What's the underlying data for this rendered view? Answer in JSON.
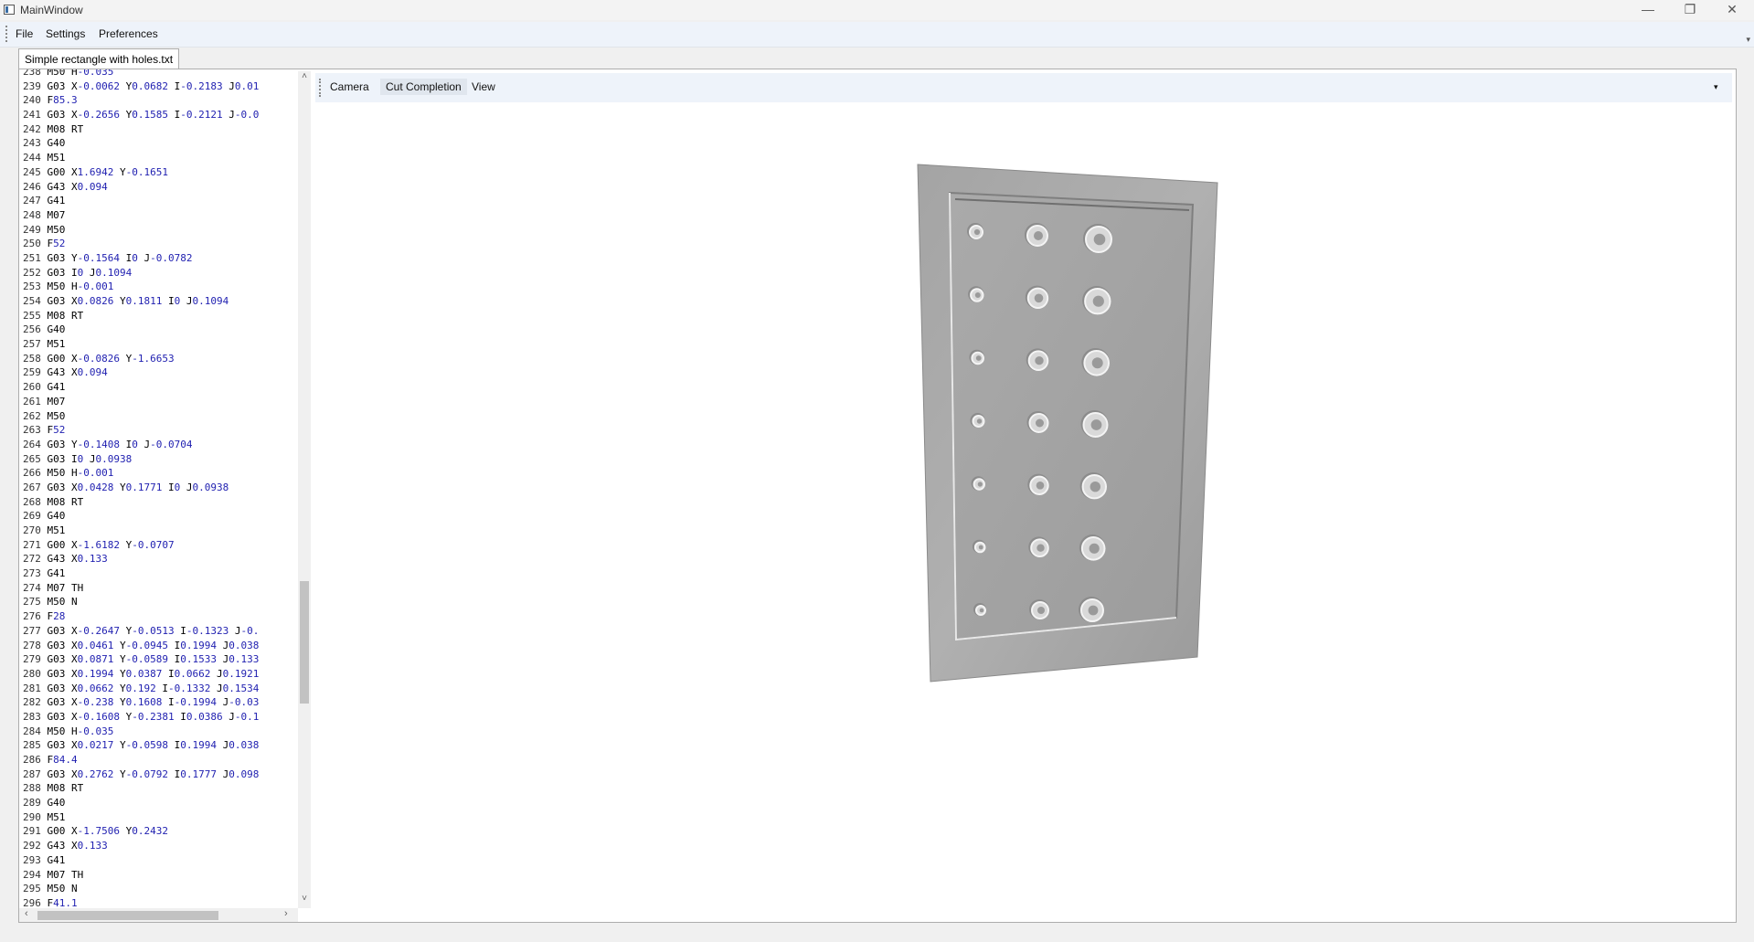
{
  "window": {
    "title": "MainWindow",
    "minimize_glyph": "—",
    "restore_glyph": "❐",
    "close_glyph": "✕"
  },
  "menu": {
    "items": [
      {
        "label": "File"
      },
      {
        "label": "Settings"
      },
      {
        "label": "Preferences"
      }
    ],
    "overflow_glyph": "▾"
  },
  "document_tab": {
    "label": "Simple rectangle with holes.txt"
  },
  "editor": {
    "lines": [
      "238 M50 H-0.035",
      "239 G03 X-0.0062 Y0.0682 I-0.2183 J0.01",
      "240 F85.3",
      "241 G03 X-0.2656 Y0.1585 I-0.2121 J-0.0",
      "242 M08 RT",
      "243 G40",
      "244 M51",
      "245 G00 X1.6942 Y-0.1651",
      "246 G43 X0.094",
      "247 G41",
      "248 M07",
      "249 M50",
      "250 F52",
      "251 G03 Y-0.1564 I0 J-0.0782",
      "252 G03 I0 J0.1094",
      "253 M50 H-0.001",
      "254 G03 X0.0826 Y0.1811 I0 J0.1094",
      "255 M08 RT",
      "256 G40",
      "257 M51",
      "258 G00 X-0.0826 Y-1.6653",
      "259 G43 X0.094",
      "260 G41",
      "261 M07",
      "262 M50",
      "263 F52",
      "264 G03 Y-0.1408 I0 J-0.0704",
      "265 G03 I0 J0.0938",
      "266 M50 H-0.001",
      "267 G03 X0.0428 Y0.1771 I0 J0.0938",
      "268 M08 RT",
      "269 G40",
      "270 M51",
      "271 G00 X-1.6182 Y-0.0707",
      "272 G43 X0.133",
      "273 G41",
      "274 M07 TH",
      "275 M50 N",
      "276 F28",
      "277 G03 X-0.2647 Y-0.0513 I-0.1323 J-0.",
      "278 G03 X0.0461 Y-0.0945 I0.1994 J0.038",
      "279 G03 X0.0871 Y-0.0589 I0.1533 J0.133",
      "280 G03 X0.1994 Y0.0387 I0.0662 J0.1921",
      "281 G03 X0.0662 Y0.192 I-0.1332 J0.1534",
      "282 G03 X-0.238 Y0.1608 I-0.1994 J-0.03",
      "283 G03 X-0.1608 Y-0.2381 I0.0386 J-0.1",
      "284 M50 H-0.035",
      "285 G03 X0.0217 Y-0.0598 I0.1994 J0.038",
      "286 F84.4",
      "287 G03 X0.2762 Y-0.0792 I0.1777 J0.098",
      "288 M08 RT",
      "289 G40",
      "290 M51",
      "291 G00 X-1.7506 Y0.2432",
      "292 G43 X0.133",
      "293 G41",
      "294 M07 TH",
      "295 M50 N",
      "296 F41.1"
    ],
    "scroll_up_glyph": "˄",
    "scroll_down_glyph": "˅",
    "scroll_left_glyph": "‹",
    "scroll_right_glyph": "›"
  },
  "viewer": {
    "toolbar": [
      {
        "label": "Camera"
      },
      {
        "label": "Cut Completion"
      },
      {
        "label": "View"
      }
    ],
    "overflow_glyph": "▾",
    "plate": {
      "rows": 7,
      "cols": 3,
      "color": "#a9a9a9"
    }
  }
}
